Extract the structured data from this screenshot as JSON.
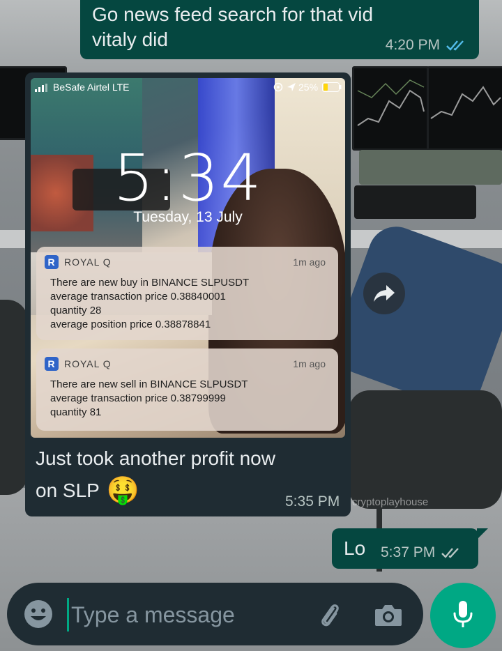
{
  "outgoing_top": {
    "text_line1": "Go news feed search for that vid",
    "text_line2": "vitaly did",
    "time": "4:20 PM"
  },
  "incoming": {
    "screenshot": {
      "carrier": "BeSafe Airtel  LTE",
      "battery": "25%",
      "lock_time": "5:34",
      "lock_date": "Tuesday, 13 July",
      "notifications": [
        {
          "app": "ROYAL Q",
          "time": "1m ago",
          "lines": [
            "There are new buy in BINANCE SLPUSDT",
            "average transaction price 0.38840001",
            "quantity 28",
            "average position price 0.38878841"
          ]
        },
        {
          "app": "ROYAL Q",
          "time": "1m ago",
          "lines": [
            "There are new sell in BINANCE SLPUSDT",
            "average transaction price 0.38799999",
            "quantity 81"
          ]
        }
      ]
    },
    "caption_line1": "Just took another profit now",
    "caption_line2": "on SLP",
    "emoji": "🤑",
    "time": "5:35 PM"
  },
  "outgoing_bottom": {
    "text": "Lo",
    "time": "5:37 PM"
  },
  "wallpaper_watermark": "cryptoplayhouse",
  "input": {
    "placeholder": "Type a message"
  },
  "colors": {
    "outgoing_bubble": "#054740",
    "incoming_bubble": "#1f2c33",
    "accent": "#00a884",
    "read_ticks": "#53bdeb"
  }
}
